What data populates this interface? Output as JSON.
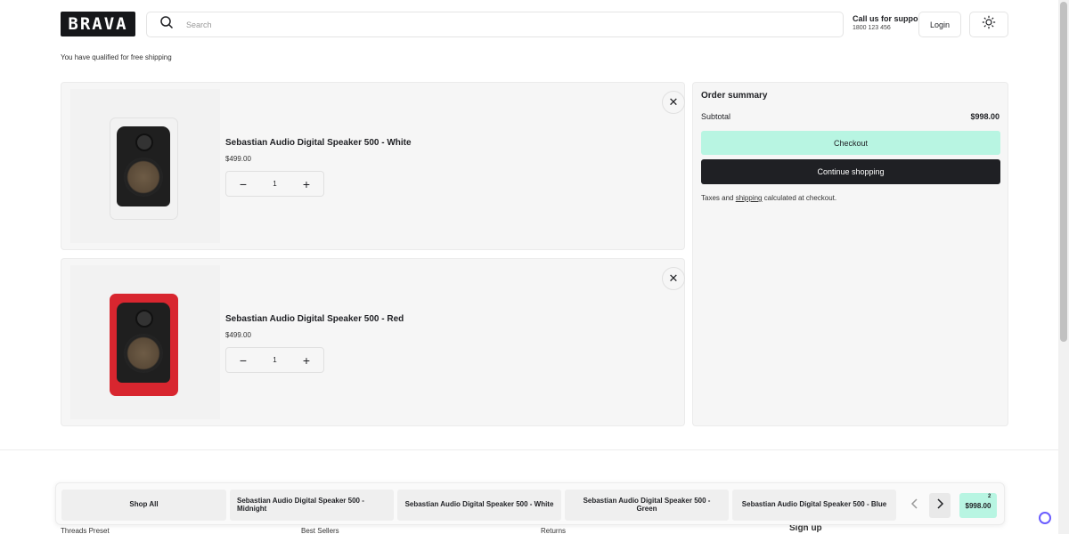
{
  "header": {
    "logo": "BRAVA",
    "search_placeholder": "Search",
    "support_title": "Call us for support",
    "support_phone": "1800 123 456",
    "login_label": "Login"
  },
  "notice": "You have qualified for free shipping",
  "cart": {
    "items": [
      {
        "name": "Sebastian Audio Digital Speaker 500 - White",
        "price": "$499.00",
        "quantity": "1",
        "color": "#f2f2f2"
      },
      {
        "name": "Sebastian Audio Digital Speaker 500 - Red",
        "price": "$499.00",
        "quantity": "1",
        "color": "#d8262f"
      }
    ]
  },
  "summary": {
    "title": "Order summary",
    "subtotal_label": "Subtotal",
    "subtotal_value": "$998.00",
    "checkout_label": "Checkout",
    "continue_label": "Continue shopping",
    "tax_pre": "Taxes and ",
    "tax_link": "shipping",
    "tax_post": " calculated at checkout."
  },
  "footer": {
    "col1": "Threads Preset",
    "col2": "Best Sellers",
    "col3": "Returns",
    "signup": "Sign up"
  },
  "bottom_bar": {
    "chips": [
      "Shop All",
      "Sebastian Audio Digital Speaker 500 - Midnight",
      "Sebastian Audio Digital Speaker 500 - White",
      "Sebastian Audio Digital Speaker 500 - Green",
      "Sebastian Audio Digital Speaker 500 - Blue"
    ],
    "cart_total": "$998.00",
    "cart_count": "2"
  },
  "colors": {
    "accent": "#b8f5e2",
    "dark": "#1f2024"
  }
}
